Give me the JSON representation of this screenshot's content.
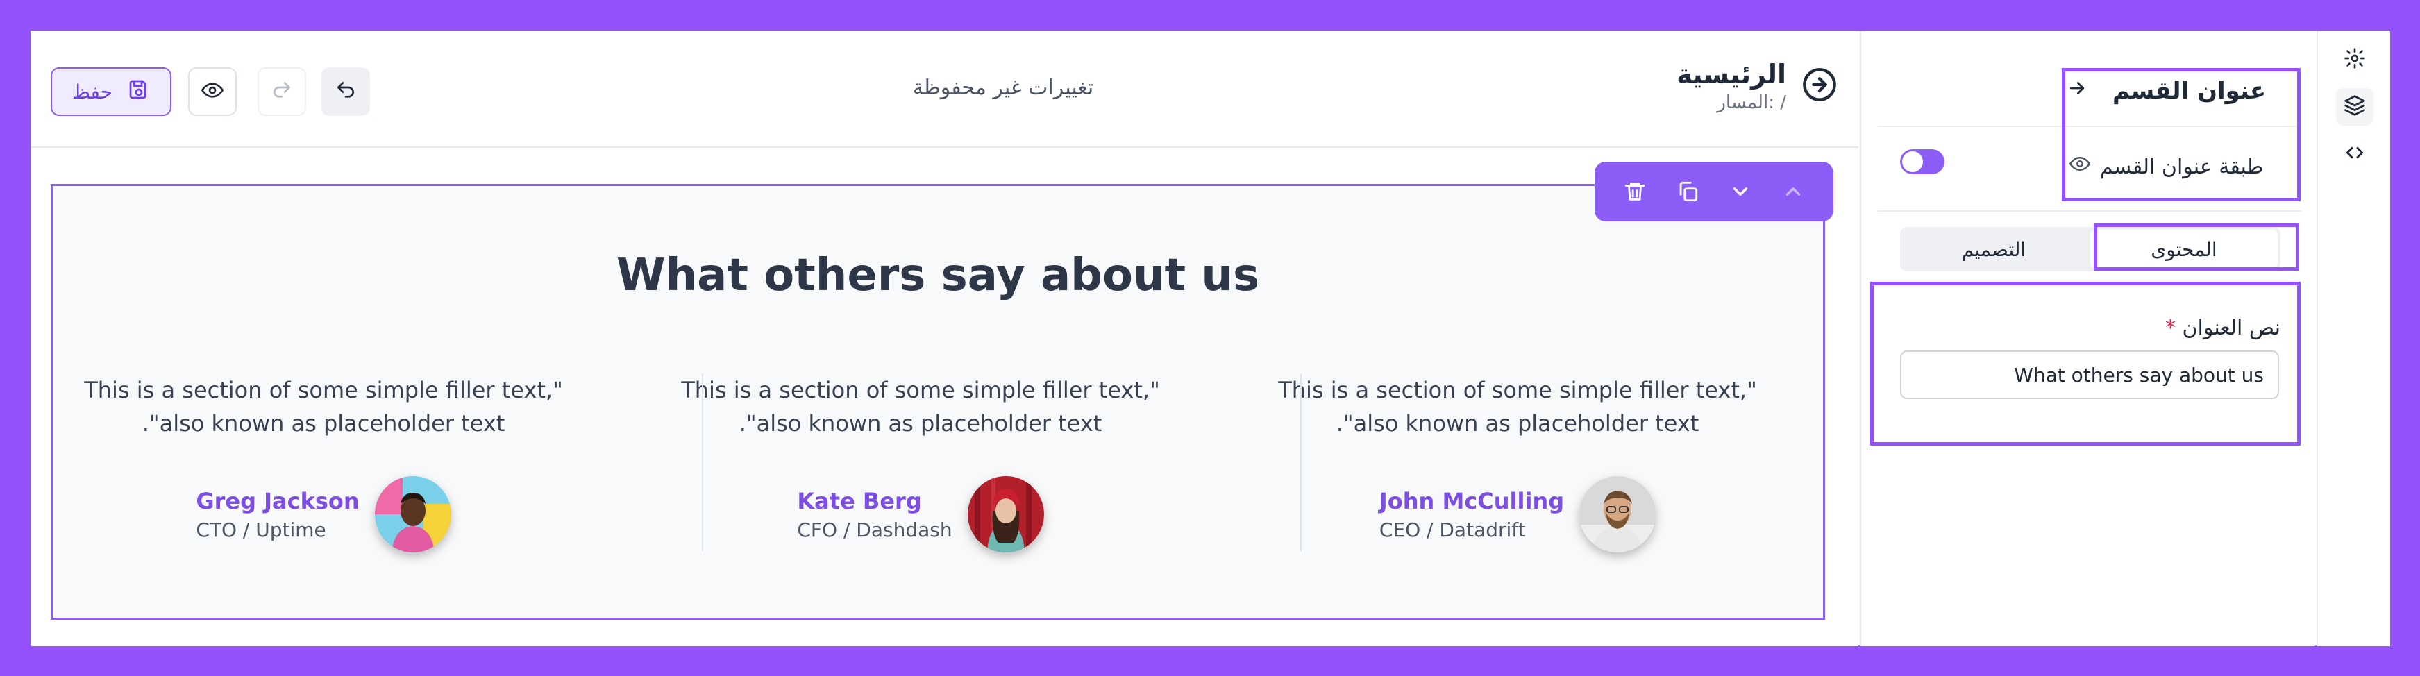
{
  "toolbar": {
    "save_label": "حفظ",
    "status_text": "تغييرات غير محفوظة"
  },
  "page": {
    "title": "الرئيسية",
    "path": "المسار: /"
  },
  "section": {
    "heading": "What others say about us",
    "testimonials": [
      {
        "quote": "\"This is a section of some simple filler text, also known as placeholder text\".",
        "name": "John McCulling",
        "role": "CEO / Datadrift"
      },
      {
        "quote": "\"This is a section of some simple filler text, also known as placeholder text\".",
        "name": "Kate Berg",
        "role": "CFO / Dashdash"
      },
      {
        "quote": "\"This is a section of some simple filler text, also known as placeholder text\".",
        "name": "Greg Jackson",
        "role": "CTO / Uptime"
      }
    ]
  },
  "panel": {
    "title": "عنوان القسم",
    "layer_label": "طبقة عنوان القسم",
    "layer_visible": true,
    "tabs": [
      {
        "label": "المحتوى",
        "active": true
      },
      {
        "label": "التصميم",
        "active": false
      }
    ],
    "field": {
      "label": "نص العنوان",
      "required_mark": "*",
      "value": "What others say about us"
    }
  },
  "icons": {
    "save": "save-icon",
    "preview": "eye-icon",
    "redo": "redo-icon",
    "undo": "undo-icon",
    "nav_back": "arrow-circle-right-icon",
    "section_actions": [
      "trash-icon",
      "copy-icon",
      "chevron-down-icon",
      "chevron-up-icon"
    ],
    "rail": [
      "gear-icon",
      "layers-icon",
      "code-icon"
    ]
  },
  "colors": {
    "accent": "#8b5cf6",
    "highlight": "#9551fc",
    "name_text": "#7c4ee4"
  }
}
